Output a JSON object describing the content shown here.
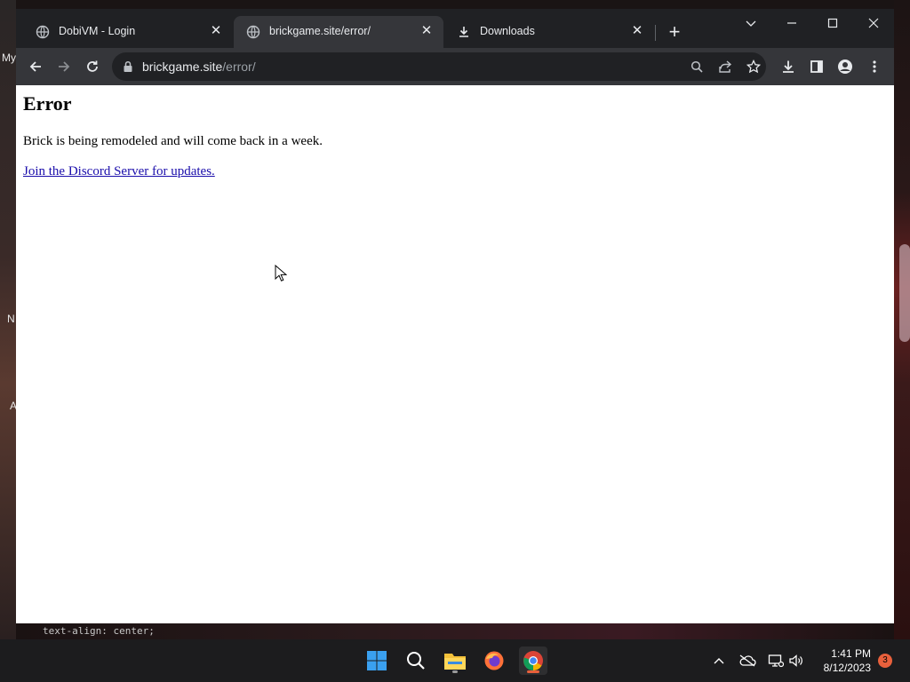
{
  "desktop": {
    "left_labels": [
      "My",
      "N",
      "A"
    ],
    "code_peek": "text-align: center;"
  },
  "browser": {
    "tabs": [
      {
        "title": "DobiVM - Login",
        "icon": "globe-icon",
        "active": false
      },
      {
        "title": "brickgame.site/error/",
        "icon": "globe-icon",
        "active": true
      },
      {
        "title": "Downloads",
        "icon": "download-icon",
        "active": false
      }
    ],
    "address": {
      "host": "brickgame.site",
      "path": "/error/"
    }
  },
  "page": {
    "heading": "Error",
    "message": "Brick is being remodeled and will come back in a week.",
    "link": "Join the Discord Server for updates."
  },
  "taskbar": {
    "time": "1:41 PM",
    "date": "8/12/2023",
    "notification_count": "3"
  },
  "colors": {
    "tabstrip": "#202124",
    "toolbar": "#35363a",
    "link": "#1a0dab",
    "accent_chrome": "#e8603c"
  }
}
